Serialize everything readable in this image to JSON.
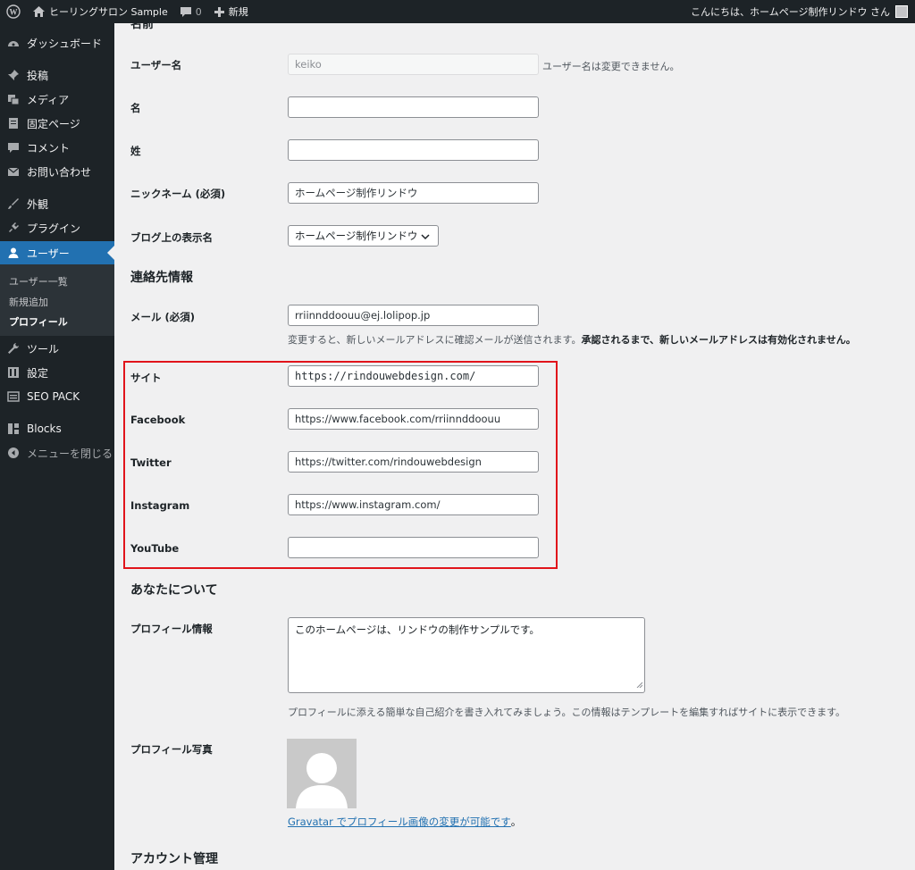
{
  "adminbar": {
    "site_name": "ヒーリングサロン Sample",
    "comments_count": "0",
    "new_label": "新規",
    "greeting": "こんにちは、ホームページ制作リンドウ さん"
  },
  "sidebar": {
    "items": [
      {
        "label": "ダッシュボード",
        "icon": "dashboard-icon"
      },
      {
        "label": "投稿",
        "icon": "pin-icon"
      },
      {
        "label": "メディア",
        "icon": "media-icon"
      },
      {
        "label": "固定ページ",
        "icon": "page-icon"
      },
      {
        "label": "コメント",
        "icon": "comment-icon"
      },
      {
        "label": "お問い合わせ",
        "icon": "mail-icon"
      },
      {
        "label": "外観",
        "icon": "brush-icon"
      },
      {
        "label": "プラグイン",
        "icon": "plugin-icon"
      },
      {
        "label": "ユーザー",
        "icon": "user-icon"
      },
      {
        "label": "ツール",
        "icon": "wrench-icon"
      },
      {
        "label": "設定",
        "icon": "settings-icon"
      },
      {
        "label": "SEO PACK",
        "icon": "seo-icon"
      },
      {
        "label": "Blocks",
        "icon": "blocks-icon"
      },
      {
        "label": "メニューを閉じる",
        "icon": "collapse-icon"
      }
    ],
    "submenu": [
      "ユーザー一覧",
      "新規追加",
      "プロフィール"
    ]
  },
  "form": {
    "top_heading_partial": "名前",
    "username": {
      "label": "ユーザー名",
      "value": "keiko",
      "note": "ユーザー名は変更できません。"
    },
    "first_name": {
      "label": "名",
      "value": ""
    },
    "last_name": {
      "label": "姓",
      "value": ""
    },
    "nickname": {
      "label": "ニックネーム (必須)",
      "value": "ホームページ制作リンドウ"
    },
    "display_name": {
      "label": "ブログ上の表示名",
      "value": "ホームページ制作リンドウ"
    },
    "contact_heading": "連絡先情報",
    "email": {
      "label": "メール (必須)",
      "value": "rriinnddoouu@ej.lolipop.jp",
      "note_normal": "変更すると、新しいメールアドレスに確認メールが送信されます。",
      "note_bold": "承認されるまで、新しいメールアドレスは有効化されません。"
    },
    "site": {
      "label": "サイト",
      "value": "https://rindouwebdesign.com/"
    },
    "facebook": {
      "label": "Facebook",
      "value": "https://www.facebook.com/rriinnddoouu"
    },
    "twitter": {
      "label": "Twitter",
      "value": "https://twitter.com/rindouwebdesign"
    },
    "instagram": {
      "label": "Instagram",
      "value": "https://www.instagram.com/"
    },
    "youtube": {
      "label": "YouTube",
      "value": ""
    },
    "about_heading": "あなたについて",
    "bio": {
      "label": "プロフィール情報",
      "value": "このホームページは、リンドウの制作サンプルです。",
      "note": "プロフィールに添える簡単な自己紹介を書き入れてみましょう。この情報はテンプレートを編集すればサイトに表示できます。"
    },
    "photo": {
      "label": "プロフィール写真",
      "link_text": "Gravatar でプロフィール画像の変更が可能です",
      "link_tail": "。"
    },
    "account_heading": "アカウント管理"
  },
  "colors": {
    "admin_dark": "#1d2327",
    "accent_blue": "#2271b1",
    "highlight_red": "#e1141b"
  }
}
